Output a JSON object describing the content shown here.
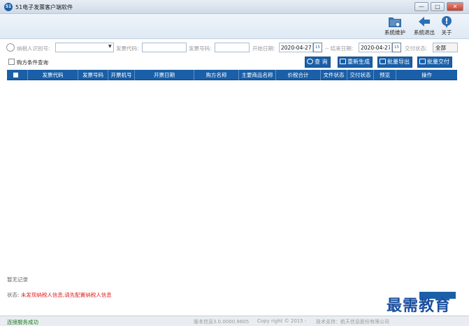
{
  "app": {
    "title": "51电子发票客户端软件",
    "logo_text": "51"
  },
  "window_controls": {
    "minimize": "—",
    "maximize": "□",
    "close": "✕"
  },
  "toolbar": {
    "items": [
      {
        "label": "系统维护",
        "icon": "folder-gear-icon"
      },
      {
        "label": "系统退出",
        "icon": "back-arrow-icon"
      },
      {
        "label": "关于",
        "icon": "info-bubble-icon"
      }
    ]
  },
  "filters": {
    "taxpayer_id_label": "纳税人识别号:",
    "taxpayer_id_value": "",
    "invoice_code_label": "发票代码:",
    "invoice_code_value": "",
    "invoice_number_label": "发票号码:",
    "invoice_number_value": "",
    "start_date_label": "开始日期:",
    "start_date_value": "2020-04-27",
    "end_date_label": "-- 结束日期:",
    "end_date_value": "2020-04-27",
    "calendar_day": "15",
    "delivery_status_label": "交付状态:",
    "delivery_status_value": "全部"
  },
  "buyer_query": {
    "label": "购方条件查询",
    "checked": false
  },
  "actions": {
    "query": "查 询",
    "regenerate": "重新生成",
    "batch_export": "批量导出",
    "batch_deliver": "批量交付"
  },
  "table": {
    "columns": [
      "发票代码",
      "发票号码",
      "开票机号",
      "开票日期",
      "购方名称",
      "主要商品名称",
      "价税合计",
      "文件状态",
      "交付状态",
      "预览",
      "操作"
    ],
    "rows": []
  },
  "messages": {
    "no_records": "暂无记录",
    "status_label": "状态:",
    "status_text": "未发现纳税人信息,请先配置纳税人信息"
  },
  "footer": {
    "connection": "连接服务成功",
    "version": "版本信息3.0.0000.9605",
    "copyright": "Copy right © 2015 -",
    "support": "技术支持：航天信息股份有限公司"
  },
  "watermark": "最需教育",
  "colors": {
    "accent": "#1a5fa7",
    "error": "#e02020",
    "success": "#1e7a1e"
  }
}
